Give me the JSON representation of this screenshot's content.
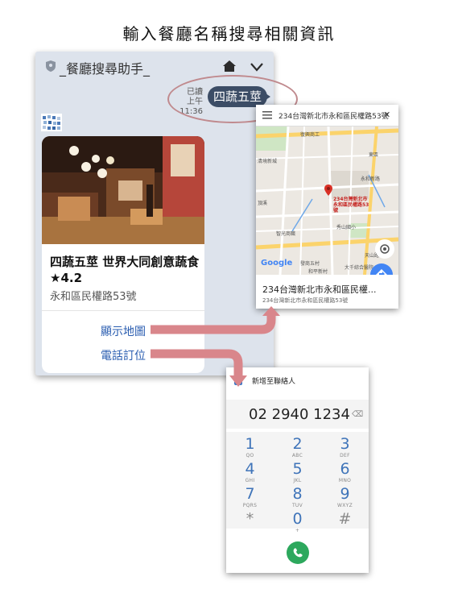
{
  "page_title": "輸入餐廳名稱搜尋相關資訊",
  "chat": {
    "name": "_餐廳搜尋助手_",
    "read_label": "已讀",
    "time": "上午11:36",
    "message": "四蔬五莖",
    "card": {
      "title": "四蔬五莖 世界大同創意蔬食★4.2",
      "address": "永和區民權路53號",
      "actions": [
        "顯示地圖",
        "電話訂位"
      ]
    }
  },
  "map": {
    "search_text": "234台灣新北市永和區民權路53號",
    "pin_label": "234台灣新北市永和區民權路53號",
    "place_name": "234台灣新北市永和區民權...",
    "place_sub": "234台灣新北市永和區民權路53號",
    "labels": [
      "復興商工",
      "清境新城",
      "東區",
      "秀山國小",
      "智光商職",
      "大千綜合醫院",
      "頂溪",
      "天山路",
      "永和新路",
      "和平新村",
      "發商五村",
      "Google"
    ]
  },
  "dialer": {
    "add_contact": "新增至聯絡人",
    "number": "02 2940 1234",
    "keys": [
      {
        "digit": "1",
        "letters": "QO"
      },
      {
        "digit": "2",
        "letters": "ABC"
      },
      {
        "digit": "3",
        "letters": "DEF"
      },
      {
        "digit": "4",
        "letters": "GHI"
      },
      {
        "digit": "5",
        "letters": "JKL"
      },
      {
        "digit": "6",
        "letters": "MNO"
      },
      {
        "digit": "7",
        "letters": "PQRS"
      },
      {
        "digit": "8",
        "letters": "TUV"
      },
      {
        "digit": "9",
        "letters": "WXYZ"
      },
      {
        "digit": "*",
        "letters": ""
      },
      {
        "digit": "0",
        "letters": "+"
      },
      {
        "digit": "#",
        "letters": ""
      }
    ]
  },
  "colors": {
    "chat_bg": "#dde3ec",
    "bubble": "#3c4d66",
    "link": "#2a5db0",
    "arrow": "#d9868b",
    "dial_digit": "#3f74b9",
    "call_green": "#2da85d"
  }
}
